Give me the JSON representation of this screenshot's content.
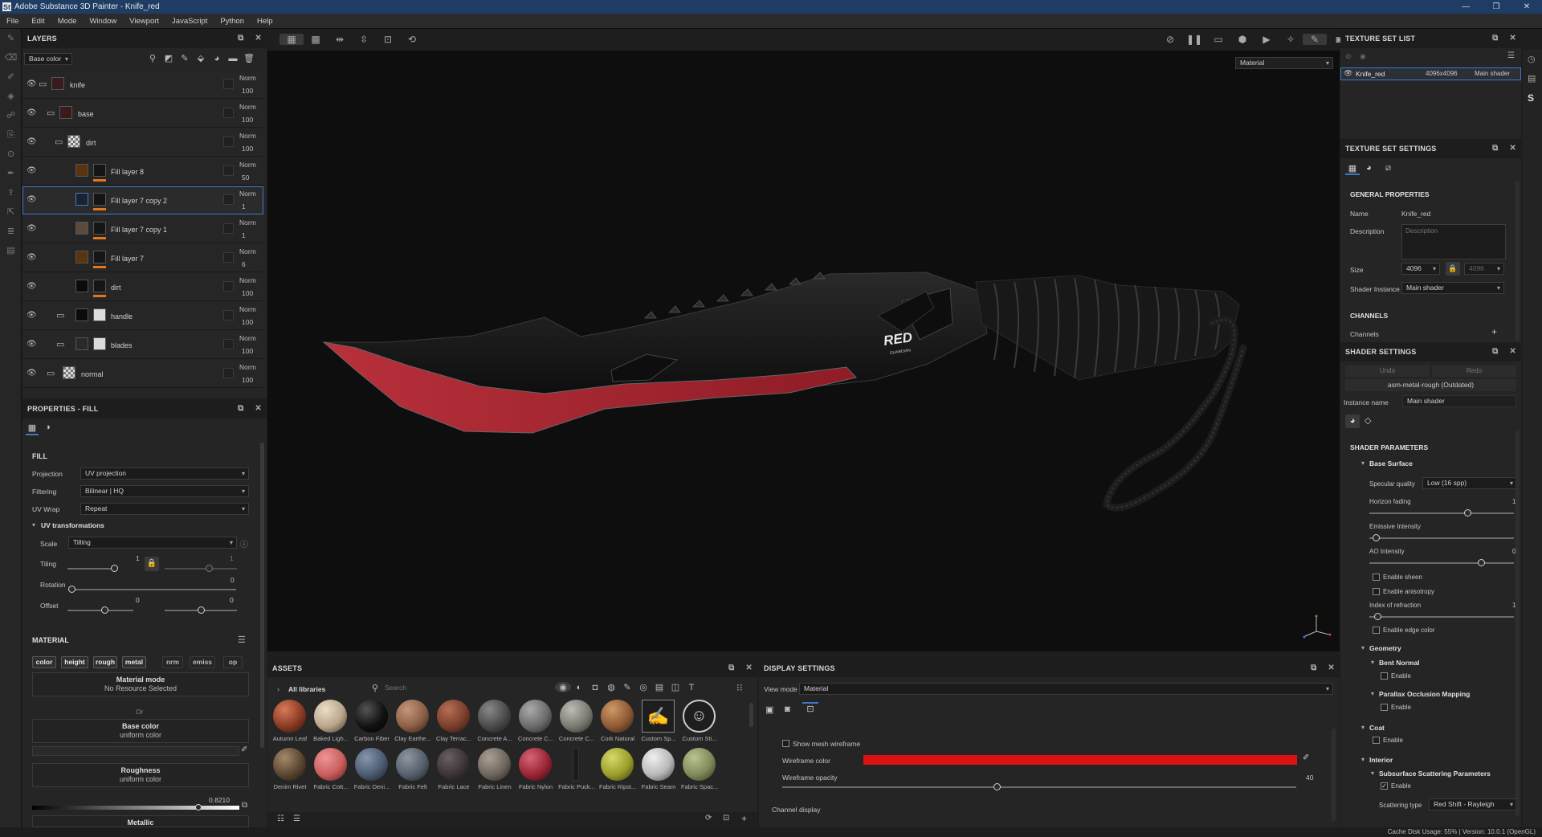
{
  "app": {
    "title": "Adobe Substance 3D Painter - Knife_red",
    "logo": "St"
  },
  "menu": [
    "File",
    "Edit",
    "Mode",
    "Window",
    "Viewport",
    "JavaScript",
    "Python",
    "Help"
  ],
  "layers": {
    "title": "LAYERS",
    "channel": "Base color",
    "rows": [
      {
        "name": "knife",
        "blend": "Norm",
        "opacity": "100"
      },
      {
        "name": "base",
        "blend": "Norm",
        "opacity": "100"
      },
      {
        "name": "dirt",
        "blend": "Norm",
        "opacity": "100"
      },
      {
        "name": "Fill layer 8",
        "blend": "Norm",
        "opacity": "50"
      },
      {
        "name": "Fill layer 7 copy 2",
        "blend": "Norm",
        "opacity": "1"
      },
      {
        "name": "Fill layer 7 copy 1",
        "blend": "Norm",
        "opacity": "1"
      },
      {
        "name": "Fill layer 7",
        "blend": "Norm",
        "opacity": "6"
      },
      {
        "name": "dirt",
        "blend": "Norm",
        "opacity": "100"
      },
      {
        "name": "handle",
        "blend": "Norm",
        "opacity": "100"
      },
      {
        "name": "blades",
        "blend": "Norm",
        "opacity": "100"
      },
      {
        "name": "normal",
        "blend": "Norm",
        "opacity": "100"
      }
    ]
  },
  "properties": {
    "title": "PROPERTIES - FILL",
    "fill": "FILL",
    "projection_label": "Projection",
    "projection": "UV projection",
    "filtering_label": "Filtering",
    "filtering": "Bilinear | HQ",
    "uvwrap_label": "UV Wrap",
    "uvwrap": "Repeat",
    "uvtrans": "UV transformations",
    "scale_label": "Scale",
    "scale": "Tilling",
    "tiling_label": "Tiling",
    "tiling_a": "1",
    "tiling_b": "1",
    "rotation_label": "Rotation",
    "rotation": "0",
    "offset_label": "Offset",
    "offset_a": "0",
    "offset_b": "0",
    "material": "MATERIAL",
    "chips": [
      "color",
      "height",
      "rough",
      "metal",
      "nrm",
      "emiss",
      "op"
    ],
    "matmode": "Material mode",
    "matmode_val": "No Resource Selected",
    "or": "Or",
    "basecolor": "Base color",
    "basecolor_val": "uniform color",
    "roughness": "Roughness",
    "roughness_val": "uniform color",
    "roughness_num": "0.8210",
    "metallic": "Metallic"
  },
  "viewport": {
    "mode": "Material"
  },
  "assets": {
    "title": "ASSETS",
    "libs": "All libraries",
    "search_placeholder": "Search",
    "items": [
      {
        "name": "Autumn Leaf",
        "color": "#8a3b22"
      },
      {
        "name": "Baked Ligh...",
        "color": "#b9a58a"
      },
      {
        "name": "Carbon Fiber",
        "color": "#111111"
      },
      {
        "name": "Clay Earthe...",
        "color": "#8a5f45"
      },
      {
        "name": "Clay Terrac...",
        "color": "#7a3e2c"
      },
      {
        "name": "Concrete A...",
        "color": "#4a4a4a"
      },
      {
        "name": "Concrete C...",
        "color": "#6b6b6b"
      },
      {
        "name": "Concrete C...",
        "color": "#7b7a72"
      },
      {
        "name": "Cork Natural",
        "color": "#8d5a35"
      },
      {
        "name": "Custom Sp...",
        "color": "#222222"
      },
      {
        "name": "Custom Sti...",
        "color": "#222222"
      },
      {
        "name": "Denim Rivet",
        "color": "#5a4630"
      },
      {
        "name": "Fabric Cott...",
        "color": "#c85d5d"
      },
      {
        "name": "Fabric Deni...",
        "color": "#4d5b70"
      },
      {
        "name": "Fabric Felt",
        "color": "#56606c"
      },
      {
        "name": "Fabric Lace",
        "color": "#3b3335"
      },
      {
        "name": "Fabric Linen",
        "color": "#6e655d"
      },
      {
        "name": "Fabric Nylon",
        "color": "#9a2535"
      },
      {
        "name": "Fabric Puck...",
        "color": "#1b1b1b"
      },
      {
        "name": "Fabric Ripst...",
        "color": "#9b9e2a"
      },
      {
        "name": "Fabric Seam",
        "color": "#b8b8b8"
      },
      {
        "name": "Fabric Spac...",
        "color": "#7f8a5a"
      }
    ]
  },
  "display": {
    "title": "DISPLAY SETTINGS",
    "viewmode_label": "View mode",
    "viewmode": "Material",
    "show_wireframe": "Show mesh wireframe",
    "wire_color_label": "Wireframe color",
    "wire_color": "#dc1111",
    "wire_opacity_label": "Wireframe opacity",
    "wire_opacity": "40",
    "channel_display": "Channel display"
  },
  "textureset": {
    "title": "TEXTURE SET LIST",
    "name": "Knife_red",
    "size": "4096x4096",
    "shader": "Main shader"
  },
  "tss": {
    "title": "TEXTURE SET SETTINGS",
    "general": "GENERAL PROPERTIES",
    "name_label": "Name",
    "name": "Knife_red",
    "desc_label": "Description",
    "desc_placeholder": "Description",
    "size_label": "Size",
    "size": "4096",
    "size2": "4096",
    "shader_label": "Shader Instance",
    "shader": "Main shader",
    "channels": "CHANNELS",
    "channels_label": "Channels"
  },
  "shader": {
    "title": "SHADER SETTINGS",
    "undo": "Undo",
    "redo": "Redo",
    "preset": "asm-metal-rough (Outdated)",
    "instance_label": "Instance name",
    "instance": "Main shader",
    "params": "SHADER PARAMETERS",
    "base_surface": "Base Surface",
    "spec_label": "Specular quality",
    "spec": "Low (16 spp)",
    "horizon_label": "Horizon fading",
    "horizon_val": "1",
    "emissive_label": "Emissive Intensity",
    "ao_label": "AO Intensity",
    "ao_val": "0.7",
    "sheen": "Enable sheen",
    "aniso": "Enable anisotropy",
    "ior_label": "Index of refraction",
    "ior_val": "1",
    "edge": "Enable edge color",
    "geometry": "Geometry",
    "bent": "Bent Normal",
    "enable": "Enable",
    "parallax": "Parallax Occlusion Mapping",
    "coat": "Coat",
    "interior": "Interior",
    "sss": "Subsurface Scattering Parameters",
    "scatter_label": "Scattering type",
    "scatter": "Red Shift - Rayleigh"
  },
  "status": "Cache Disk Usage:   55% | Version: 10.0.1 (OpenGL)",
  "knife": {
    "brand": "RED",
    "brand_sub": "GUARDIAN"
  }
}
